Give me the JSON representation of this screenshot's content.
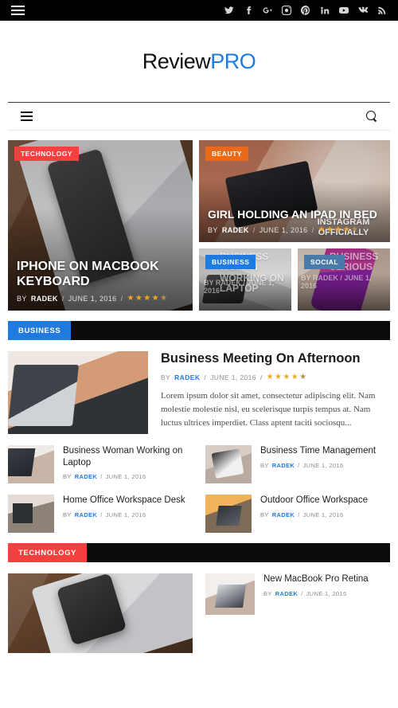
{
  "topbar": {
    "menu_label": "Menu",
    "social": [
      {
        "name": "twitter-icon",
        "label": "Twitter"
      },
      {
        "name": "facebook-icon",
        "label": "Facebook"
      },
      {
        "name": "google-plus-icon",
        "label": "Google Plus"
      },
      {
        "name": "instagram-icon",
        "label": "Instagram"
      },
      {
        "name": "pinterest-icon",
        "label": "Pinterest"
      },
      {
        "name": "linkedin-icon",
        "label": "LinkedIn"
      },
      {
        "name": "youtube-icon",
        "label": "YouTube"
      },
      {
        "name": "vk-icon",
        "label": "VK"
      },
      {
        "name": "rss-icon",
        "label": "RSS"
      }
    ]
  },
  "logo": {
    "part1": "Review",
    "part2": "PRO"
  },
  "navbar": {
    "menu_label": "Menu",
    "search_label": "Search"
  },
  "colors": {
    "red": "#f3413f",
    "orange": "#ea6a1c",
    "blue": "#1f7be0",
    "slate": "#4a7ba8",
    "star": "#f5a623",
    "link": "#1f7be0"
  },
  "hero": {
    "main": {
      "category": "TECHNOLOGY",
      "title": "IPHONE ON MACBOOK KEYBOARD",
      "by_label": "BY",
      "author": "RADEK",
      "sep": "/",
      "date": "JUNE 1, 2016",
      "rating": 4.5
    },
    "top_right": {
      "category": "BEAUTY",
      "title": "GIRL HOLDING AN IPAD IN BED",
      "by_label": "BY",
      "author": "RADEK",
      "sep": "/",
      "date": "JUNE 1, 2016",
      "rating": 4.5,
      "ghost_text": "INSTAGRAM OFFICIALLY"
    },
    "bottom_left": {
      "category": "BUSINESS",
      "ghost_title": "BUSINESS WOMAN WORKING ON LAPTOP",
      "ghost_meta": "BY RADEK / JUNE 1, 2016"
    },
    "bottom_right": {
      "category": "SOCIAL",
      "ghost_title": "BUSINESS SERIOUS",
      "ghost_meta": "BY RADEK / JUNE 1, 2016"
    }
  },
  "business_section": {
    "heading": "BUSINESS",
    "feature": {
      "title": "Business Meeting On Afternoon",
      "by_label": "BY",
      "author": "RADEK",
      "sep": "/",
      "date": "JUNE 1, 2016",
      "rating": 4.5,
      "excerpt": "Lorem ipsum dolor sit amet, consectetur adipiscing elit. Nam molestie molestie nisl, eu scelerisque turpis tempus at. Nam luctus ultrices imperdiet. Class aptent taciti sociosqu..."
    },
    "items": [
      {
        "title": "Business Woman Working on Laptop",
        "by_label": "BY",
        "author": "RADEK",
        "sep": "/",
        "date": "JUNE 1, 2016"
      },
      {
        "title": "Business Time Management",
        "by_label": "BY",
        "author": "RADEK",
        "sep": "/",
        "date": "JUNE 1, 2016"
      },
      {
        "title": "Home Office Workspace Desk",
        "by_label": "BY",
        "author": "RADEK",
        "sep": "/",
        "date": "JUNE 1, 2016"
      },
      {
        "title": "Outdoor Office Workspace",
        "by_label": "BY",
        "author": "RADEK",
        "sep": "/",
        "date": "JUNE 1, 2016"
      }
    ]
  },
  "technology_section": {
    "heading": "TECHNOLOGY",
    "items": [
      {
        "title": "New MacBook Pro Retina",
        "by_label": "BY",
        "author": "RADEK",
        "sep": "/",
        "date": "JUNE 1, 2016"
      }
    ]
  }
}
